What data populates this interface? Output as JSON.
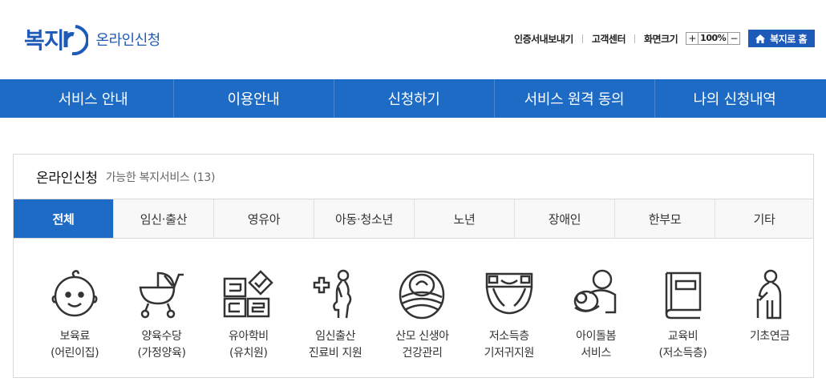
{
  "header": {
    "logo_mark": "복지",
    "logo_text": "온라인신청",
    "util": {
      "cert": "인증서내보내기",
      "help": "고객센터",
      "zoom_label": "화면크기",
      "zoom_in": "+",
      "zoom_value": "100%",
      "zoom_out": "−",
      "home": "복지로 홈"
    }
  },
  "gnb": {
    "items": [
      {
        "label": "서비스 안내"
      },
      {
        "label": "이용안내"
      },
      {
        "label": "신청하기"
      },
      {
        "label": "서비스 원격 동의"
      },
      {
        "label": "나의 신청내역"
      }
    ]
  },
  "panel": {
    "title": "온라인신청",
    "subtitle": "가능한 복지서비스 (13)",
    "tabs": [
      {
        "label": "전체"
      },
      {
        "label": "임신·출산"
      },
      {
        "label": "영유아"
      },
      {
        "label": "아동·청소년"
      },
      {
        "label": "노년"
      },
      {
        "label": "장애인"
      },
      {
        "label": "한부모"
      },
      {
        "label": "기타"
      }
    ],
    "services": [
      {
        "line1": "보육료",
        "line2": "(어린이집)",
        "icon": "baby-face-icon"
      },
      {
        "line1": "양육수당",
        "line2": "(가정양육)",
        "icon": "stroller-icon"
      },
      {
        "line1": "유아학비",
        "line2": "(유치원)",
        "icon": "blocks-icon"
      },
      {
        "line1": "임신출산",
        "line2": "진료비 지원",
        "icon": "pregnant-woman-icon"
      },
      {
        "line1": "산모 신생아",
        "line2": "건강관리",
        "icon": "newborn-icon"
      },
      {
        "line1": "저소득층",
        "line2": "기저귀지원",
        "icon": "diaper-icon"
      },
      {
        "line1": "아이돌봄",
        "line2": "서비스",
        "icon": "childcare-icon"
      },
      {
        "line1": "교육비",
        "line2": "(저소득층)",
        "icon": "book-icon"
      },
      {
        "line1": "기초연금",
        "line2": "",
        "icon": "elderly-icon"
      }
    ]
  },
  "colors": {
    "brand": "#1e6bc6",
    "logo": "#1e5bb8"
  }
}
